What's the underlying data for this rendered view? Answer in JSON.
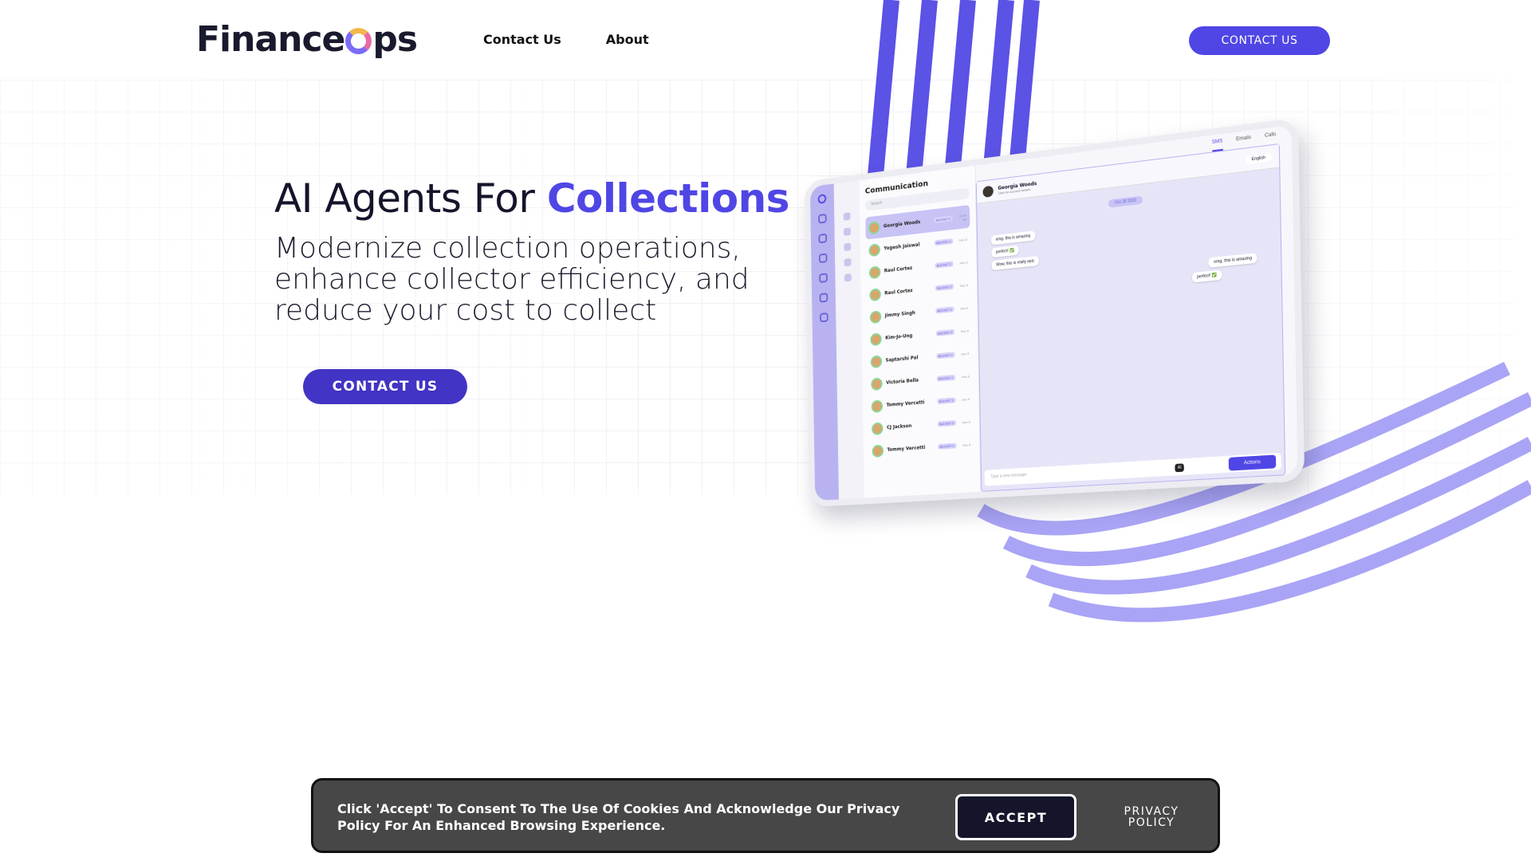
{
  "brand": {
    "logo_text_left": "Finance",
    "logo_text_right": "ps",
    "colors": {
      "accent": "#4f46e5",
      "accent_dark": "#4234c4",
      "stripe": "#5b52e6",
      "stripe_light": "#a9a4f5"
    }
  },
  "nav": {
    "items": [
      {
        "label": "Contact Us"
      },
      {
        "label": "About"
      }
    ],
    "cta_label": "CONTACT US"
  },
  "hero": {
    "title_plain": "AI Agents For ",
    "title_accent": "Collections",
    "subtitle": "Modernize collection operations, enhance collector efficiency, and reduce your cost to collect",
    "cta_label": "CONTACT US"
  },
  "mockup": {
    "section_title": "Communication",
    "search_placeholder": "Search",
    "tabs": [
      "SMS",
      "Emails",
      "Calls"
    ],
    "contacts": [
      {
        "name": "Georgia Woods",
        "tag": "BUCKET 2",
        "time": "09:00 AM"
      },
      {
        "name": "Yogesh Jaiswal",
        "tag": "BUCKET 2",
        "time": "Dec 8"
      },
      {
        "name": "Raul Cortez",
        "tag": "BUCKET 2",
        "time": "Dec 8"
      },
      {
        "name": "Raul Cortez",
        "tag": "BUCKET 2",
        "time": "Dec 8"
      },
      {
        "name": "Jimmy Singh",
        "tag": "BUCKET 2",
        "time": "Dec 8"
      },
      {
        "name": "Kim-Jo-Ung",
        "tag": "BUCKET 2",
        "time": "Dec 8"
      },
      {
        "name": "Saptarshi Pal",
        "tag": "BUCKET 2",
        "time": "Dec 8"
      },
      {
        "name": "Victoria Bella",
        "tag": "BUCKET 2",
        "time": "Dec 8"
      },
      {
        "name": "Tommy Vercetti",
        "tag": "BUCKET 2",
        "time": "Dec 8"
      },
      {
        "name": "CJ Jackson",
        "tag": "BUCKET 2",
        "time": "Dec 8"
      },
      {
        "name": "Tommy Vercetti",
        "tag": "BUCKET 2",
        "time": "Dec 8"
      }
    ],
    "chat": {
      "name": "Georgia Woods",
      "subtitle": "Click for account details",
      "date": "Oct 28 2023",
      "language": "English",
      "incoming": [
        "omg, this is amazing",
        "perfect! ✅",
        "Wow, this is really epic"
      ],
      "outgoing": [
        "omg, this is amazing",
        "perfect! ✅"
      ],
      "input_placeholder": "Type a new message",
      "ai_label": "AI",
      "actions_label": "Actions"
    }
  },
  "cookie": {
    "message": "Click 'Accept' To Consent To The Use Of Cookies And Acknowledge Our Privacy Policy For An Enhanced Browsing Experience.",
    "accept_label": "ACCEPT",
    "privacy_line1": "PRIVACY",
    "privacy_line2": "POLICY"
  }
}
